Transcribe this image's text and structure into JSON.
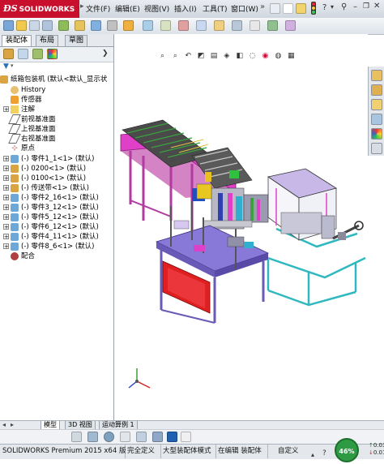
{
  "app": {
    "logo_text": "SOLIDWORKS",
    "brand_color": "#c8102e"
  },
  "menu": [
    "文件(F)",
    "编辑(E)",
    "视图(V)",
    "插入(I)",
    "工具(T)",
    "窗口(W)"
  ],
  "panel_tabs": [
    "装配体",
    "布局",
    "草图"
  ],
  "tree": {
    "root": "纸箱包装机  (默认<默认_显示状",
    "items": [
      "History",
      "传感器",
      "注解",
      "前视基准面",
      "上视基准面",
      "右视基准面",
      "原点",
      "(-) 零件1_1<1> (默认)",
      "(-) 0200<1> (默认)",
      "(-) 0100<1> (默认)",
      "(-) 传送带<1> (默认)",
      "(-) 零件2_16<1> (默认)",
      "(-) 零件3_12<1> (默认)",
      "(-) 零件5_12<1> (默认)",
      "(-) 零件6_12<1> (默认)",
      "(-) 零件4_11<1> (默认)",
      "(-) 零件8_6<1> (默认)",
      "配合"
    ]
  },
  "bottom_tabs": [
    "模型",
    "3D 视图",
    "运动算例 1"
  ],
  "status": {
    "product": "SOLIDWORKS Premium 2015 x64 版",
    "defined": "完全定义",
    "mode": "大型装配体模式",
    "editing": "在编辑 装配体",
    "custom": "自定义",
    "gauge": "46%",
    "net_up": "0.03K",
    "net_down": "0.01K"
  },
  "colors": {
    "magenta_frame": "#e040c8",
    "cyan_frame": "#40c8c8",
    "violet_panel": "#8878d8",
    "red_box": "#e02020",
    "gauge_green": "#2e9a43"
  },
  "icons": [
    "home-icon",
    "new-icon",
    "open-icon",
    "save-icon",
    "print-icon",
    "undo-icon",
    "select-icon",
    "rebuild-icon",
    "options-icon",
    "help-icon",
    "search-icon",
    "zoom-fit-icon",
    "zoom-area-icon",
    "previous-view-icon",
    "section-view-icon",
    "view-orientation-icon",
    "display-style-icon",
    "hide-show-icon",
    "appearance-icon",
    "scene-icon",
    "view-settings-icon",
    "resources-icon",
    "design-library-icon",
    "file-explorer-icon",
    "view-palette-icon",
    "appearances-icon",
    "custom-properties-icon"
  ]
}
